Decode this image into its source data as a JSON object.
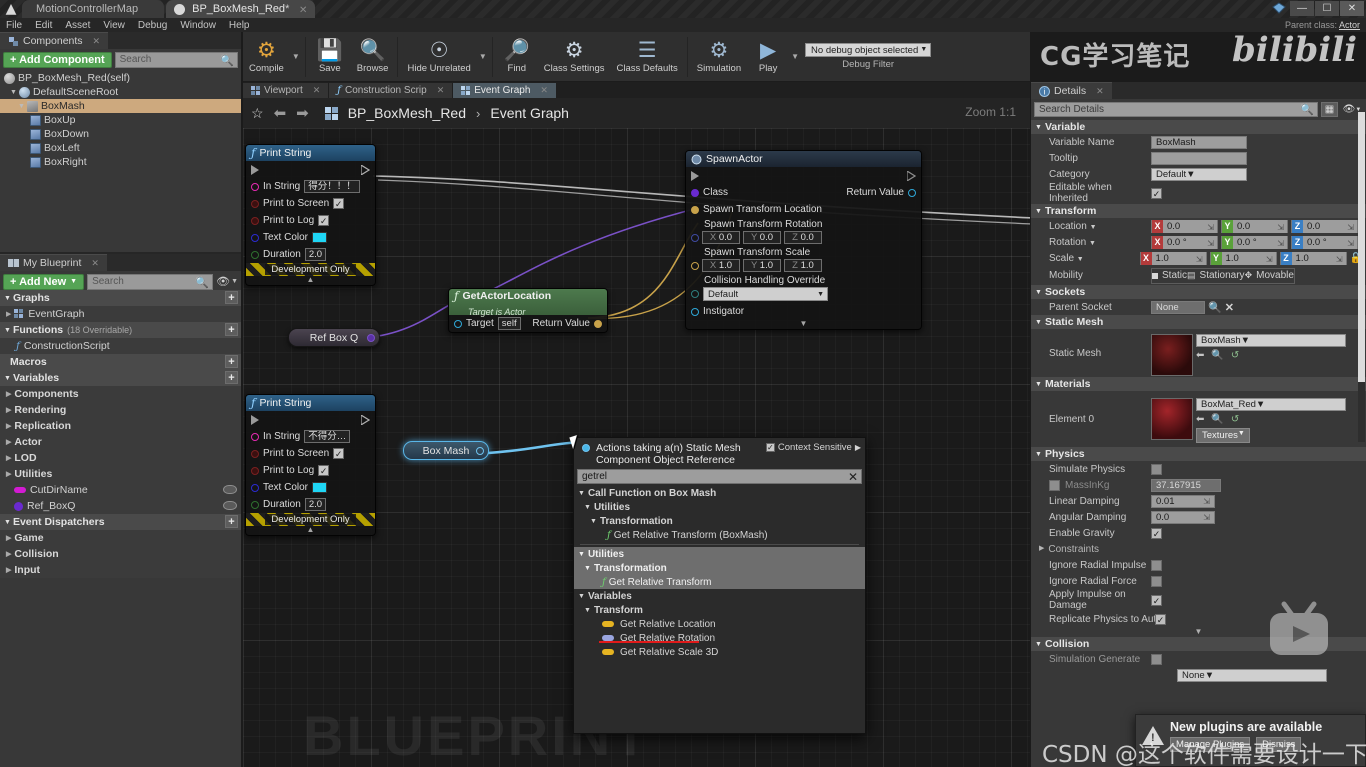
{
  "window": {
    "tabs": [
      {
        "label": "MotionControllerMap",
        "active": false,
        "closable": false
      },
      {
        "label": "BP_BoxMesh_Red",
        "active": true,
        "closable": true,
        "dirty": "*"
      }
    ],
    "controls": [
      "minimize",
      "restore",
      "close"
    ]
  },
  "menu": {
    "items": [
      "File",
      "Edit",
      "Asset",
      "View",
      "Debug",
      "Window",
      "Help"
    ]
  },
  "parent_class": {
    "label": "Parent class:",
    "value": "Actor"
  },
  "watermarks": {
    "cg": "CG学习笔记",
    "bilibili": "bilibili",
    "graph": "BLUEPRINT",
    "csdn": "CSDN @这个软件需要设计一下"
  },
  "components_panel": {
    "tab": "Components",
    "add_button": "+ Add Component",
    "search_placeholder": "Search",
    "tree": [
      {
        "label": "BP_BoxMesh_Red(self)",
        "icon": "sphere-icon",
        "indent": 0,
        "selected": false,
        "arrow": ""
      },
      {
        "label": "DefaultSceneRoot",
        "icon": "root-icon",
        "indent": 1,
        "selected": false,
        "arrow": "▼"
      },
      {
        "label": "BoxMash",
        "icon": "home-icon",
        "indent": 2,
        "selected": true,
        "arrow": "▼"
      },
      {
        "label": "BoxUp",
        "icon": "cube-icon",
        "indent": 3,
        "selected": false,
        "arrow": ""
      },
      {
        "label": "BoxDown",
        "icon": "cube-icon",
        "indent": 3,
        "selected": false,
        "arrow": ""
      },
      {
        "label": "BoxLeft",
        "icon": "cube-icon",
        "indent": 3,
        "selected": false,
        "arrow": ""
      },
      {
        "label": "BoxRight",
        "icon": "cube-icon",
        "indent": 3,
        "selected": false,
        "arrow": ""
      }
    ]
  },
  "myblueprint_panel": {
    "tab": "My Blueprint",
    "add_button": "+ Add New",
    "search_placeholder": "Search",
    "sections": [
      {
        "title": "Graphs",
        "note": "",
        "items": [
          {
            "label": "EventGraph",
            "icon": "graph-icon",
            "expandable": true,
            "color": ""
          }
        ]
      },
      {
        "title": "Functions",
        "note": "(18 Overridable)",
        "items": [
          {
            "label": "ConstructionScript",
            "icon": "function-icon",
            "expandable": false,
            "color": ""
          }
        ]
      },
      {
        "title": "Macros",
        "note": "",
        "items": []
      },
      {
        "title": "Variables",
        "note": "",
        "items": [
          {
            "label": "Components",
            "icon": "",
            "expandable": true,
            "color": ""
          },
          {
            "label": "Rendering",
            "icon": "",
            "expandable": true,
            "color": ""
          },
          {
            "label": "Replication",
            "icon": "",
            "expandable": true,
            "color": ""
          },
          {
            "label": "Actor",
            "icon": "",
            "expandable": true,
            "color": ""
          },
          {
            "label": "LOD",
            "icon": "",
            "expandable": true,
            "color": ""
          },
          {
            "label": "Utilities",
            "icon": "",
            "expandable": true,
            "color": ""
          },
          {
            "label": "CutDirName",
            "icon": "pill-icon",
            "expandable": false,
            "color": "#d21bd2"
          },
          {
            "label": "Ref_BoxQ",
            "icon": "pill-icon",
            "expandable": false,
            "color": "#6a2ad0"
          }
        ]
      },
      {
        "title": "Event Dispatchers",
        "note": "",
        "items": [
          {
            "label": "Game",
            "icon": "",
            "expandable": true,
            "color": ""
          },
          {
            "label": "Collision",
            "icon": "",
            "expandable": true,
            "color": ""
          },
          {
            "label": "Input",
            "icon": "",
            "expandable": true,
            "color": ""
          }
        ]
      }
    ]
  },
  "toolbar": {
    "buttons": [
      {
        "label": "Compile",
        "icon": "compile-icon",
        "caret": true
      },
      {
        "label": "Save",
        "icon": "save-icon",
        "caret": false
      },
      {
        "label": "Browse",
        "icon": "browse-icon",
        "caret": false
      },
      {
        "label": "Hide Unrelated",
        "icon": "hide-unrelated-icon",
        "caret": true
      },
      {
        "label": "Find",
        "icon": "find-icon",
        "caret": false
      },
      {
        "label": "Class Settings",
        "icon": "class-settings-icon",
        "caret": false
      },
      {
        "label": "Class Defaults",
        "icon": "class-defaults-icon",
        "caret": false
      },
      {
        "label": "Simulation",
        "icon": "simulation-icon",
        "caret": false
      },
      {
        "label": "Play",
        "icon": "play-icon",
        "caret": true
      }
    ],
    "debug_value": "No debug object selected",
    "debug_label": "Debug Filter"
  },
  "graph_tabs": [
    {
      "label": "Viewport",
      "icon": "viewport-icon",
      "active": false
    },
    {
      "label": "Construction Scrip",
      "icon": "function-icon",
      "active": false
    },
    {
      "label": "Event Graph",
      "icon": "graph-icon",
      "active": true
    }
  ],
  "breadcrumb": {
    "star": "☆",
    "back": "⬅",
    "forward": "➡",
    "root": "BP_BoxMesh_Red",
    "separator": "›",
    "leaf": "Event Graph",
    "zoom": "Zoom 1:1"
  },
  "nodes": {
    "print_string_1": {
      "title": "Print String",
      "rows": [
        {
          "label": "In String",
          "value": "得分！！！",
          "type": "text"
        },
        {
          "label": "Print to Screen",
          "value": "✓",
          "type": "checkbox"
        },
        {
          "label": "Print to Log",
          "value": "✓",
          "type": "checkbox"
        },
        {
          "label": "Text Color",
          "value": "#1fd6f5",
          "type": "color"
        },
        {
          "label": "Duration",
          "value": "2.0",
          "type": "text"
        }
      ],
      "footer": "Development Only"
    },
    "print_string_2": {
      "title": "Print String",
      "rows": [
        {
          "label": "In String",
          "value": "不得分…",
          "type": "text"
        },
        {
          "label": "Print to Screen",
          "value": "✓",
          "type": "checkbox"
        },
        {
          "label": "Print to Log",
          "value": "✓",
          "type": "checkbox"
        },
        {
          "label": "Text Color",
          "value": "#1fd6f5",
          "type": "color"
        },
        {
          "label": "Duration",
          "value": "2.0",
          "type": "text"
        }
      ],
      "footer": "Development Only"
    },
    "get_actor_location": {
      "title": "GetActorLocation",
      "subtitle": "Target is Actor",
      "target_label": "Target",
      "target_value": "self",
      "return_label": "Return Value"
    },
    "spawn_actor": {
      "title": "SpawnActor",
      "class_label": "Class",
      "return_label": "Return Value",
      "loc_label": "Spawn Transform Location",
      "rot_label": "Spawn Transform Rotation",
      "rot": {
        "x": "0.0",
        "y": "0.0",
        "z": "0.0"
      },
      "scale_label": "Spawn Transform Scale",
      "scale": {
        "x": "1.0",
        "y": "1.0",
        "z": "1.0"
      },
      "collision_label": "Collision Handling Override",
      "collision_value": "Default",
      "instigator_label": "Instigator"
    },
    "ref_box_q": {
      "label": "Ref Box Q"
    },
    "box_mash": {
      "label": "Box Mash"
    }
  },
  "context_menu": {
    "title": "Actions taking a(n) Static Mesh Component Object Reference",
    "context_sensitive_label": "Context Sensitive",
    "context_sensitive_checked": "✓",
    "search_value": "getrel",
    "clear_icon": "✕",
    "groups": [
      {
        "type": "category",
        "label": "Call Function on Box Mash",
        "indent": 0
      },
      {
        "type": "category",
        "label": "Utilities",
        "indent": 1
      },
      {
        "type": "category",
        "label": "Transformation",
        "indent": 2
      },
      {
        "type": "function",
        "label": "Get Relative Transform (BoxMash)",
        "indent": 3,
        "icon": "function-icon"
      },
      {
        "type": "divider",
        "label": "",
        "indent": 0
      },
      {
        "type": "category",
        "label": "Utilities",
        "indent": 0,
        "highlight": true
      },
      {
        "type": "category",
        "label": "Transformation",
        "indent": 1,
        "highlight": true
      },
      {
        "type": "function",
        "label": "Get Relative Transform",
        "indent": 2,
        "icon": "function-icon",
        "highlight": true
      },
      {
        "type": "category",
        "label": "Variables",
        "indent": 0
      },
      {
        "type": "category",
        "label": "Transform",
        "indent": 1
      },
      {
        "type": "variable",
        "label": "Get Relative Location",
        "indent": 2,
        "color": "#e6b422"
      },
      {
        "type": "variable",
        "label": "Get Relative Rotation",
        "indent": 2,
        "color": "#9aa6e0",
        "underlined": true
      },
      {
        "type": "variable",
        "label": "Get Relative Scale 3D",
        "indent": 2,
        "color": "#e6b422"
      }
    ]
  },
  "details_panel": {
    "tab": "Details",
    "search_placeholder": "Search Details",
    "sections": [
      {
        "title": "Variable",
        "rows": [
          {
            "label": "Variable Name",
            "value": "BoxMash",
            "type": "text"
          },
          {
            "label": "Tooltip",
            "value": "",
            "type": "text"
          },
          {
            "label": "Category",
            "value": "Default",
            "type": "dropdown"
          },
          {
            "label": "Editable when Inherited",
            "value": "✓",
            "type": "checkbox"
          }
        ]
      },
      {
        "title": "Transform",
        "rows": [
          {
            "label": "Location",
            "type": "vector",
            "x": "0.0",
            "y": "0.0",
            "z": "0.0"
          },
          {
            "label": "Rotation",
            "type": "vector",
            "x": "0.0 °",
            "y": "0.0 °",
            "z": "0.0 °"
          },
          {
            "label": "Scale",
            "type": "vector",
            "x": "1.0",
            "y": "1.0",
            "z": "1.0"
          },
          {
            "label": "Mobility",
            "type": "mobility",
            "options": [
              "Static",
              "Stationary",
              "Movable"
            ],
            "selected": "Movable"
          }
        ]
      },
      {
        "title": "Sockets",
        "rows": [
          {
            "label": "Parent Socket",
            "value": "None",
            "type": "socket"
          }
        ]
      },
      {
        "title": "Static Mesh",
        "rows": [
          {
            "label": "Static Mesh",
            "value": "BoxMash",
            "type": "asset"
          }
        ]
      },
      {
        "title": "Materials",
        "rows": [
          {
            "label": "Element 0",
            "value": "BoxMat_Red",
            "type": "material",
            "extra": "Textures"
          }
        ]
      },
      {
        "title": "Physics",
        "rows": [
          {
            "label": "Simulate Physics",
            "value": "",
            "type": "checkbox_off"
          },
          {
            "label": "MassInKg",
            "value": "37.167915",
            "type": "text_disabled"
          },
          {
            "label": "Linear Damping",
            "value": "0.01",
            "type": "text"
          },
          {
            "label": "Angular Damping",
            "value": "0.0",
            "type": "text"
          },
          {
            "label": "Enable Gravity",
            "value": "✓",
            "type": "checkbox"
          },
          {
            "label": "Constraints",
            "value": "",
            "type": "expander"
          },
          {
            "label": "Ignore Radial Impulse",
            "value": "",
            "type": "checkbox_off"
          },
          {
            "label": "Ignore Radial Force",
            "value": "",
            "type": "checkbox_off"
          },
          {
            "label": "Apply Impulse on Damage",
            "value": "✓",
            "type": "checkbox"
          },
          {
            "label": "Replicate Physics to Autono",
            "value": "✓",
            "type": "checkbox"
          }
        ]
      },
      {
        "title": "Collision",
        "rows": [
          {
            "label": "Simulation Generate",
            "value": "",
            "type": "checkbox_off"
          },
          {
            "label": "",
            "value": "None",
            "type": "dropdown"
          }
        ]
      }
    ]
  },
  "notification": {
    "title": "New plugins are available",
    "buttons": [
      "Manage Plugins",
      "Dismiss"
    ],
    "icon": "warning-icon"
  }
}
